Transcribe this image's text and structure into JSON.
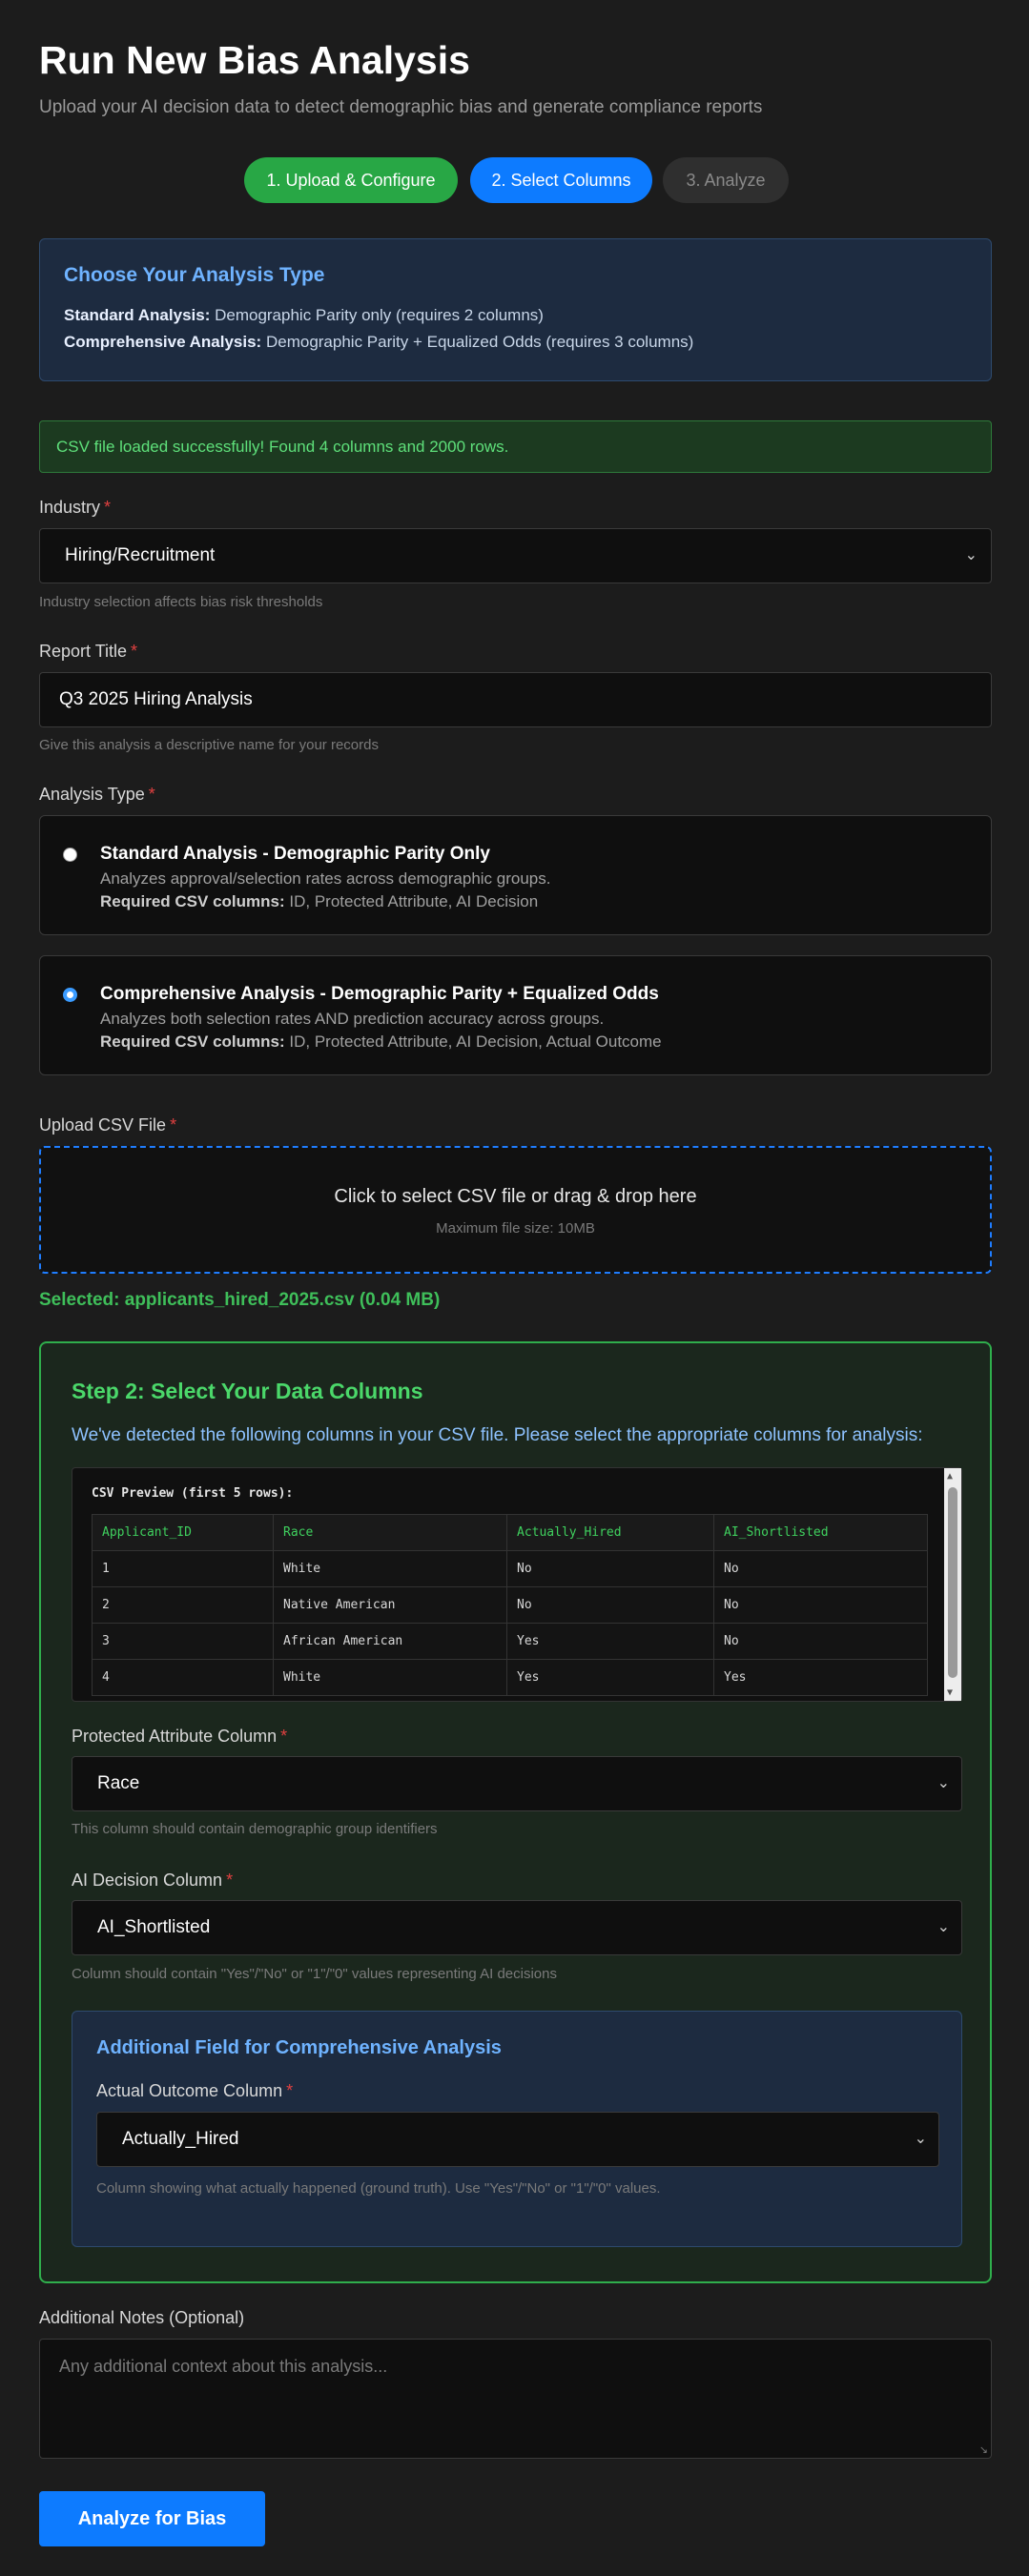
{
  "header": {
    "title": "Run New Bias Analysis",
    "subtitle": "Upload your AI decision data to detect demographic bias and generate compliance reports"
  },
  "steps": [
    {
      "label": "1. Upload & Configure",
      "state": "complete",
      "color": "#28a745"
    },
    {
      "label": "2. Select Columns",
      "state": "active",
      "color": "#0d7bff"
    },
    {
      "label": "3. Analyze",
      "state": "pending",
      "color": "#2f2f2f"
    }
  ],
  "info": {
    "title": "Choose Your Analysis Type",
    "standard_label": "Standard Analysis:",
    "standard_text": "Demographic Parity only (requires 2 columns)",
    "comprehensive_label": "Comprehensive Analysis:",
    "comprehensive_text": "Demographic Parity + Equalized Odds (requires 3 columns)"
  },
  "alert": {
    "text": "CSV file loaded successfully! Found 4 columns and 2000 rows."
  },
  "industry": {
    "label": "Industry",
    "required": "*",
    "value": "Hiring/Recruitment",
    "help": "Industry selection affects bias risk thresholds"
  },
  "report_title": {
    "label": "Report Title",
    "required": "*",
    "value": "Q3 2025 Hiring Analysis",
    "help": "Give this analysis a descriptive name for your records"
  },
  "analysis_type": {
    "label": "Analysis Type",
    "required": "*",
    "options": [
      {
        "title": "Standard Analysis - Demographic Parity Only",
        "desc": "Analyzes approval/selection rates across demographic groups.",
        "req_label": "Required CSV columns:",
        "req_text": "ID, Protected Attribute, AI Decision",
        "checked": false
      },
      {
        "title": "Comprehensive Analysis - Demographic Parity + Equalized Odds",
        "desc": "Analyzes both selection rates AND prediction accuracy across groups.",
        "req_label": "Required CSV columns:",
        "req_text": "ID, Protected Attribute, AI Decision, Actual Outcome",
        "checked": true
      }
    ]
  },
  "upload": {
    "label": "Upload CSV File",
    "required": "*",
    "drop_text": "Click to select CSV file or drag & drop here",
    "max_size": "Maximum file size: 10MB",
    "selected": "Selected: applicants_hired_2025.csv (0.04 MB)"
  },
  "step2": {
    "title": "Step 2: Select Your Data Columns",
    "intro": "We've detected the following columns in your CSV file. Please select the appropriate columns for analysis:",
    "preview_title": "CSV Preview (first 5 rows):",
    "columns": [
      "Applicant_ID",
      "Race",
      "Actually_Hired",
      "AI_Shortlisted"
    ],
    "rows": [
      [
        "1",
        "White",
        "No",
        "No"
      ],
      [
        "2",
        "Native American",
        "No",
        "No"
      ],
      [
        "3",
        "African American",
        "Yes",
        "No"
      ],
      [
        "4",
        "White",
        "Yes",
        "Yes"
      ]
    ],
    "protected": {
      "label": "Protected Attribute Column",
      "required": "*",
      "value": "Race",
      "help": "This column should contain demographic group identifiers"
    },
    "decision": {
      "label": "AI Decision Column",
      "required": "*",
      "value": "AI_Shortlisted",
      "help": "Column should contain \"Yes\"/\"No\" or \"1\"/\"0\" values representing AI decisions"
    },
    "extra": {
      "title": "Additional Field for Comprehensive Analysis",
      "label": "Actual Outcome Column",
      "required": "*",
      "value": "Actually_Hired",
      "help": "Column showing what actually happened (ground truth). Use \"Yes\"/\"No\" or \"1\"/\"0\" values."
    }
  },
  "notes": {
    "label": "Additional Notes (Optional)",
    "placeholder": "Any additional context about this analysis..."
  },
  "submit": {
    "label": "Analyze for Bias"
  }
}
